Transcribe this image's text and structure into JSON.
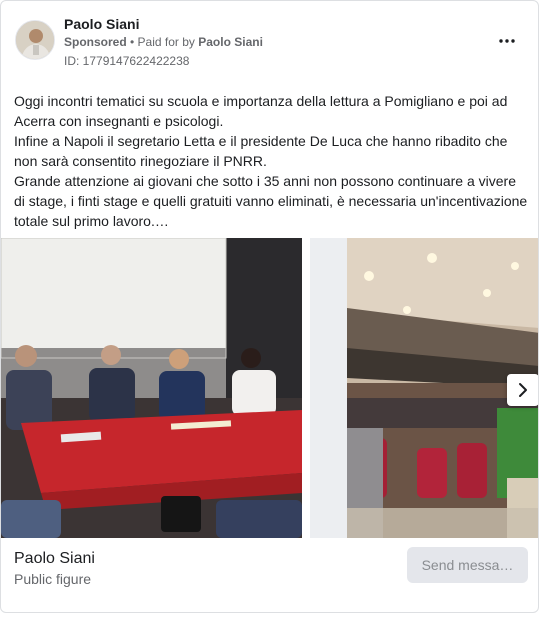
{
  "post": {
    "author": "Paolo Siani",
    "sponsored_label": "Sponsored",
    "separator": " • ",
    "paid_for_prefix": "Paid for by ",
    "paid_for_name": "Paolo Siani",
    "ad_id": "ID: 1779147622422238",
    "more_icon": "more-horizontal-icon",
    "body_lines": [
      "Oggi incontri tematici su scuola e importanza della lettura a Pomigliano e poi ad Acerra con insegnanti e psicologi.",
      "Infine a Napoli il segretario Letta e il presidente De Luca che hanno ribadito che non sarà consentito rinegoziare il PNRR.",
      "Grande attenzione ai giovani che sotto i 35 anni non possono continuare a vivere di stage, i finti stage e quelli gratuiti vanno eliminati, è necessaria un'incentivazione totale sul primo lavoro.…"
    ]
  },
  "carousel": {
    "next_icon": "chevron-right-icon"
  },
  "footer": {
    "name": "Paolo Siani",
    "subtitle": "Public figure",
    "send_label": "Send messa…"
  },
  "colors": {
    "secondary_text": "#65676b",
    "tablecloth_red": "#c6262c",
    "button_bg": "#e4e6eb"
  }
}
